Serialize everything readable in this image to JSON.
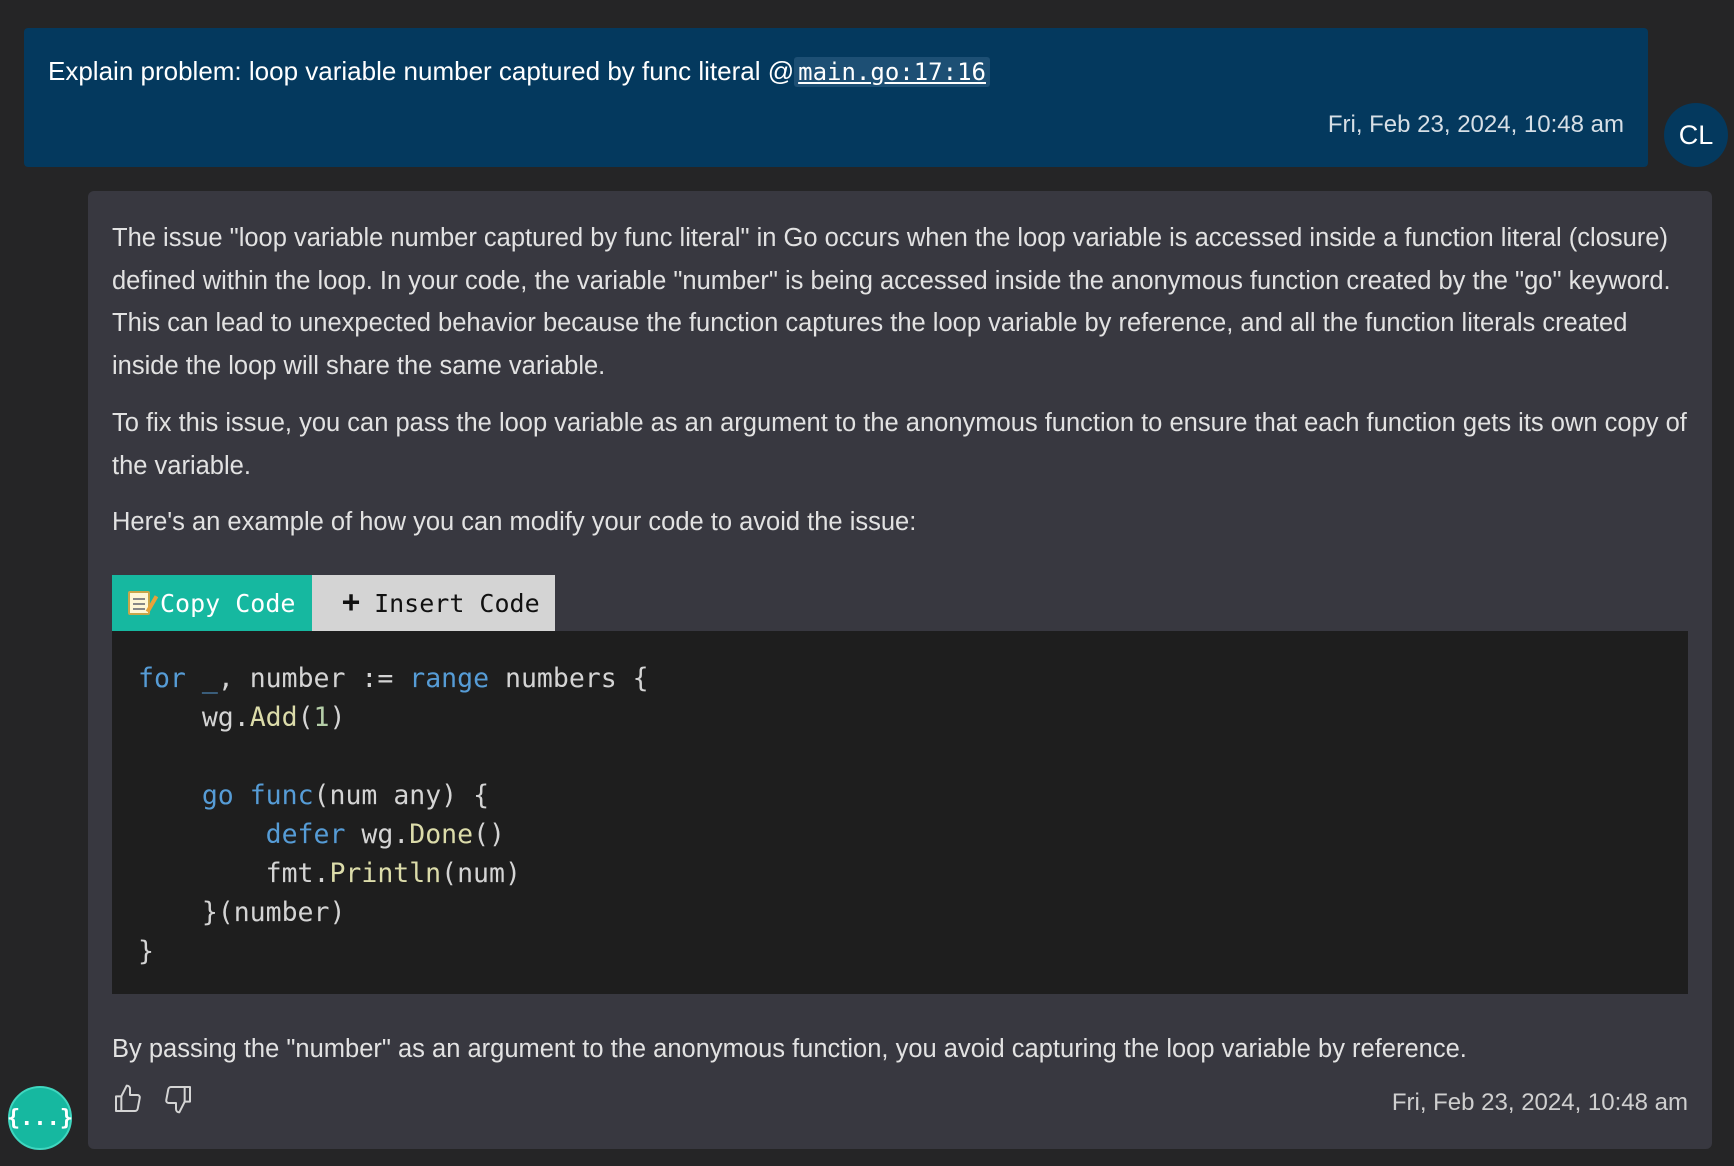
{
  "user_message": {
    "text_prefix": "Explain problem: loop variable number captured by func literal @",
    "file_ref": "main.go:17:16",
    "timestamp": "Fri, Feb 23, 2024, 10:48 am",
    "avatar_initials": "CL"
  },
  "assistant_message": {
    "paragraphs": [
      "The issue \"loop variable number captured by func literal\" in Go occurs when the loop variable is accessed inside a function literal (closure) defined within the loop. In your code, the variable \"number\" is being accessed inside the anonymous function created by the \"go\" keyword. This can lead to unexpected behavior because the function captures the loop variable by reference, and all the function literals created inside the loop will share the same variable.",
      "To fix this issue, you can pass the loop variable as an argument to the anonymous function to ensure that each function gets its own copy of the variable.",
      "Here's an example of how you can modify your code to avoid the issue:",
      "By passing the \"number\" as an argument to the anonymous function, you avoid capturing the loop variable by reference."
    ],
    "code_toolbar": {
      "copy_label": "Copy Code",
      "copy_icon": "memo-icon",
      "insert_label": "Insert Code",
      "insert_icon": "plus-icon"
    },
    "code_lines": [
      "for _, number := range numbers {",
      "    wg.Add(1)",
      "",
      "    go func(num any) {",
      "        defer wg.Done()",
      "        fmt.Println(num)",
      "    }(number)",
      "}"
    ],
    "timestamp": "Fri, Feb 23, 2024, 10:48 am",
    "avatar_label": "{...}"
  },
  "colors": {
    "user_bubble": "#04395e",
    "assistant_bubble": "#383840",
    "accent_teal": "#16b8a0",
    "code_bg": "#1e1e1e",
    "keyword": "#569cd6",
    "function": "#dcdcaa",
    "number": "#b5cea8"
  }
}
